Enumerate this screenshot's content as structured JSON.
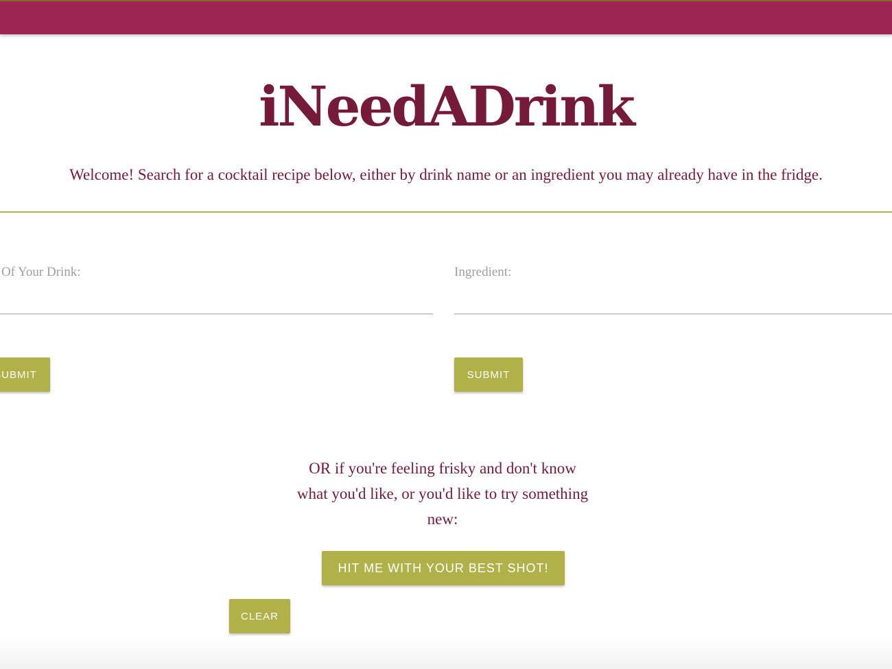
{
  "header": {
    "site_title": "iNeedADrink",
    "welcome_text": "Welcome! Search for a cocktail recipe below, either by drink name or an ingredient you may already have in the fridge."
  },
  "search": {
    "drink_name_label": "me Of Your Drink:",
    "drink_name_value": "",
    "drink_submit_label": "SUBMIT",
    "ingredient_label": "Ingredient:",
    "ingredient_value": "",
    "ingredient_submit_label": "SUBMIT"
  },
  "random": {
    "prompt_text": "OR if you're feeling frisky and don't know what you'd like, or you'd like to try something new:",
    "button_label": "HIT ME WITH YOUR BEST SHOT!"
  },
  "actions": {
    "clear_label": "CLEAR"
  },
  "colors": {
    "nav_bar": "#9e2553",
    "title_text": "#751a39",
    "accent_button": "#b0b149",
    "divider": "#b0b149",
    "label_gray": "#9e9e9e"
  }
}
